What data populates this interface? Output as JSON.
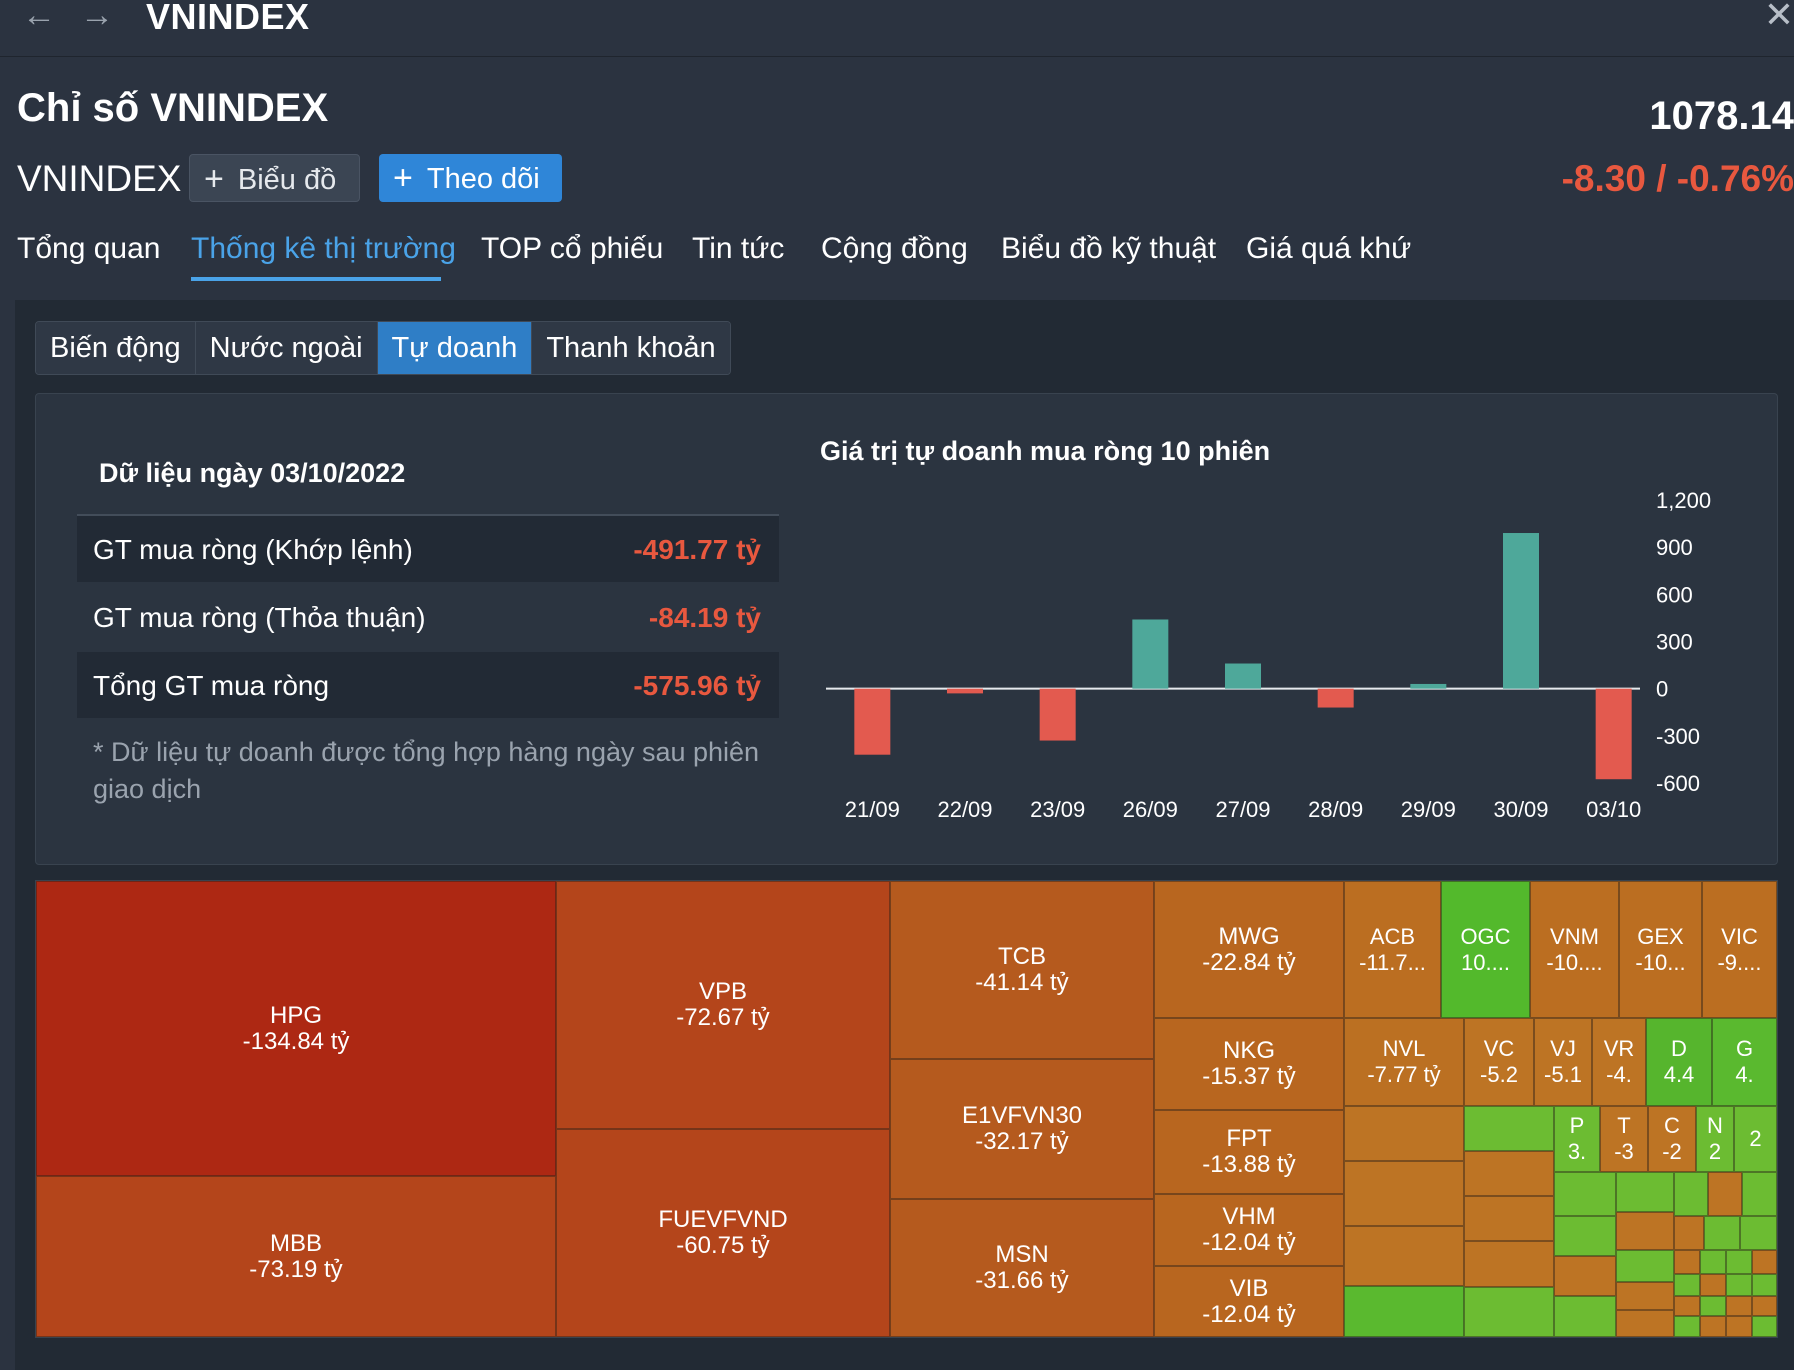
{
  "window": {
    "title": "VNINDEX",
    "back_icon": "←",
    "forward_icon": "→",
    "close_icon": "✕"
  },
  "header": {
    "title": "Chỉ số VNINDEX",
    "ticker": "VNINDEX",
    "price": "1078.14",
    "change": "-8.30 / -0.76%",
    "buttons": {
      "chart": "Biểu đồ",
      "follow": "Theo dõi"
    }
  },
  "tabs": [
    "Tổng quan",
    "Thống kê thị trường",
    "TOP cổ phiếu",
    "Tin tức",
    "Cộng đồng",
    "Biểu đồ kỹ thuật",
    "Giá quá khứ"
  ],
  "subtabs": [
    "Biến động",
    "Nước ngoài",
    "Tự doanh",
    "Thanh khoản"
  ],
  "summary": {
    "date_label": "Dữ liệu ngày 03/10/2022",
    "rows": [
      {
        "label": "GT mua ròng (Khớp lệnh)",
        "value": "-491.77 tỷ"
      },
      {
        "label": "GT mua ròng (Thỏa thuận)",
        "value": "-84.19 tỷ"
      },
      {
        "label": "Tổng GT mua ròng",
        "value": "-575.96 tỷ"
      }
    ],
    "footnote": "* Dữ liệu tự doanh được tổng hợp hàng ngày sau phiên giao dịch"
  },
  "colors": {
    "positive": "#4ea89a",
    "negative": "#e35a4f",
    "accent": "#2f86d8",
    "down_text": "#e8583f"
  },
  "chart_data": {
    "type": "bar",
    "title": "Giá trị tự doanh mua ròng 10 phiên",
    "categories": [
      "21/09",
      "22/09",
      "23/09",
      "26/09",
      "27/09",
      "28/09",
      "29/09",
      "30/09",
      "03/10"
    ],
    "values": [
      -420,
      -30,
      -330,
      440,
      160,
      -120,
      30,
      990,
      -576
    ],
    "ylim": [
      -600,
      1200
    ],
    "yticks": [
      "1,200",
      "900",
      "600",
      "300",
      "0",
      "-300",
      "-600"
    ],
    "grid": false
  },
  "treemap": {
    "cells": [
      {
        "name": "HPG",
        "value": "-134.84 tỷ"
      },
      {
        "name": "MBB",
        "value": "-73.19 tỷ"
      },
      {
        "name": "VPB",
        "value": "-72.67 tỷ"
      },
      {
        "name": "FUEVFVND",
        "value": "-60.75 tỷ"
      },
      {
        "name": "TCB",
        "value": "-41.14 tỷ"
      },
      {
        "name": "E1VFVN30",
        "value": "-32.17 tỷ"
      },
      {
        "name": "MSN",
        "value": "-31.66 tỷ"
      },
      {
        "name": "MWG",
        "value": "-22.84 tỷ"
      },
      {
        "name": "NKG",
        "value": "-15.37 tỷ"
      },
      {
        "name": "FPT",
        "value": "-13.88 tỷ"
      },
      {
        "name": "VHM",
        "value": "-12.04 tỷ"
      },
      {
        "name": "VIB",
        "value": "-12.04 tỷ"
      },
      {
        "name": "ACB",
        "value": "-11.7..."
      },
      {
        "name": "OGC",
        "value": "10...."
      },
      {
        "name": "VNM",
        "value": "-10...."
      },
      {
        "name": "GEX",
        "value": "-10..."
      },
      {
        "name": "VIC",
        "value": "-9...."
      },
      {
        "name": "NVL",
        "value": "-7.77 tỷ"
      },
      {
        "name": "VC",
        "value": "-5.2"
      },
      {
        "name": "VJ",
        "value": "-5.1"
      },
      {
        "name": "VR",
        "value": "-4."
      },
      {
        "name": "D",
        "value": "4.4"
      },
      {
        "name": "G",
        "value": "4."
      },
      {
        "name": "P",
        "value": "3."
      },
      {
        "name": "T",
        "value": "-3"
      },
      {
        "name": "C",
        "value": "-2"
      },
      {
        "name": "N",
        "value": "2"
      },
      {
        "name": "",
        "value": "2"
      }
    ]
  }
}
